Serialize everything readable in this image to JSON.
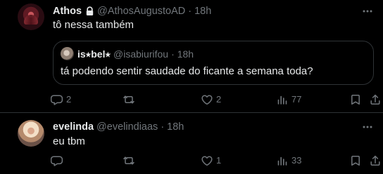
{
  "tweets": [
    {
      "name": "Athos",
      "handle": "@AthosAugustoAD",
      "time": "18h",
      "text": "tô nessa também",
      "quote": {
        "name": "is⭑bel⭑",
        "handle": "@isabiurifou",
        "time": "18h",
        "text": "tá podendo sentir saudade do ficante a semana toda?"
      },
      "actions": {
        "replies": "2",
        "retweets": "",
        "likes": "2",
        "views": "77"
      },
      "icons": [
        "lock-icon",
        "more-icon",
        "reply-icon",
        "retweet-icon",
        "like-icon",
        "views-icon",
        "bookmark-icon",
        "share-icon"
      ]
    },
    {
      "name": "evelinda",
      "handle": "@evelindiaas",
      "time": "18h",
      "text": "eu tbm",
      "actions": {
        "replies": "",
        "retweets": "",
        "likes": "1",
        "views": "33"
      },
      "icons": [
        "more-icon",
        "reply-icon",
        "retweet-icon",
        "like-icon",
        "views-icon",
        "bookmark-icon",
        "share-icon"
      ]
    }
  ],
  "colors": {
    "background": "#000000",
    "primary_text": "#e7e9ea",
    "secondary_text": "#71767b",
    "border": "#2f3336"
  }
}
